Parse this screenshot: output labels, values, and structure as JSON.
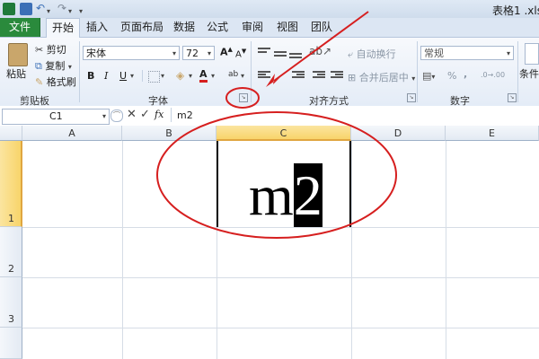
{
  "window": {
    "title": "表格1 .xls"
  },
  "tabs": [
    "文件",
    "开始",
    "插入",
    "页面布局",
    "数据",
    "公式",
    "审阅",
    "视图",
    "团队"
  ],
  "clipboard": {
    "paste": "粘贴",
    "cut": "剪切",
    "copy": "复制",
    "format_painter": "格式刷",
    "group_label": "剪贴板"
  },
  "font": {
    "name": "宋体",
    "size": "72",
    "bold": "B",
    "italic": "I",
    "underline": "U",
    "font_color": "A",
    "group_label": "字体",
    "phonetic": "ab"
  },
  "alignment": {
    "wrap_text": "自动换行",
    "merge_center": "合并后居中",
    "group_label": "对齐方式"
  },
  "number": {
    "format": "常规",
    "percent": "%",
    "comma": ",",
    "group_label": "数字"
  },
  "styles": {
    "conditional_format": "条件格"
  },
  "formula_bar": {
    "cell_ref": "C1",
    "content": "m2",
    "fx": "fx"
  },
  "columns": [
    "A",
    "B",
    "C",
    "D",
    "E"
  ],
  "rows": [
    "1",
    "2",
    "3"
  ],
  "cells": {
    "C1_base": "m",
    "C1_selected": "2"
  },
  "colors": {
    "file_tab": "#2a8a3c",
    "selected_header": "#f8d46a",
    "annotation": "#d61f1f"
  }
}
